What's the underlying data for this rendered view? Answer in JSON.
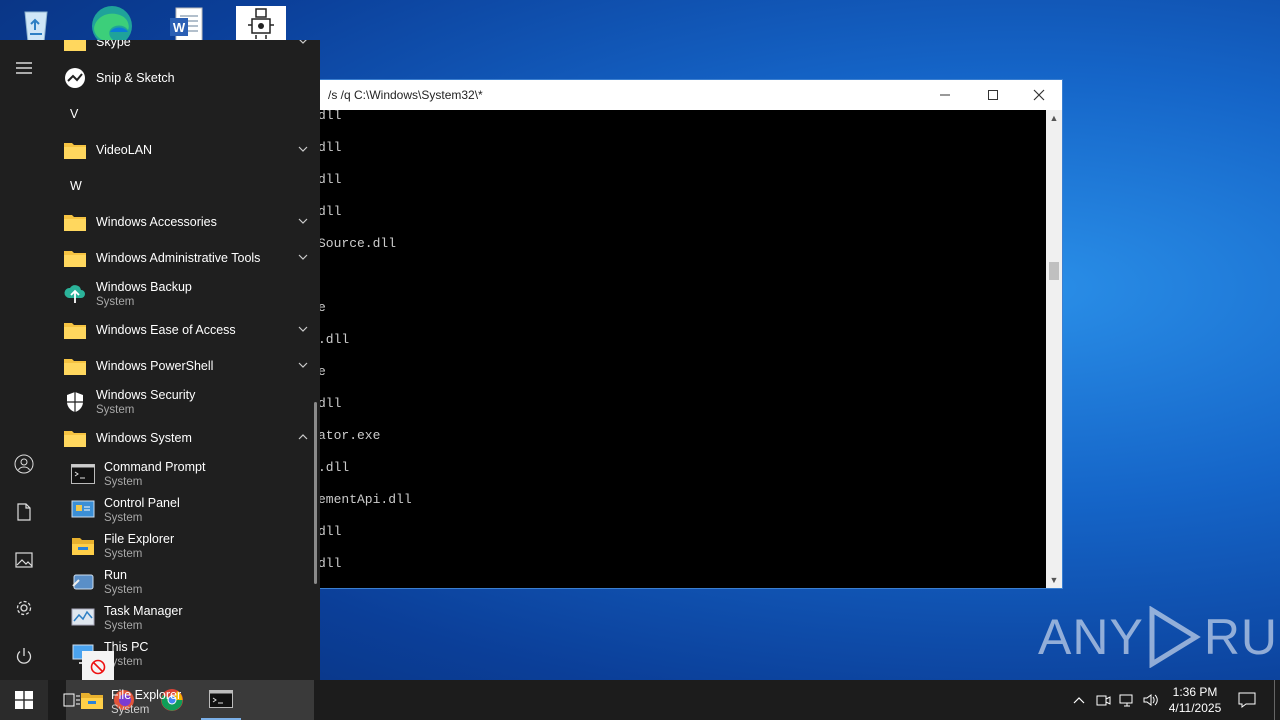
{
  "desktop": {
    "icons": [
      "recycle-bin-icon",
      "edge-icon",
      "word-document-icon",
      "application-icon"
    ]
  },
  "console": {
    "title": "/s /q C:\\Windows\\System32\\*",
    "lines": [
      "dll",
      "dll",
      "dll",
      "dll",
      "Source.dll",
      "",
      "e",
      ".dll",
      "e",
      "dll",
      "ator.exe",
      ".dll",
      "ementApi.dll",
      "dll",
      "dll"
    ],
    "minimize": "—",
    "maximize": "☐",
    "close": "✕"
  },
  "start_menu": {
    "partial_top": {
      "name": "Skype"
    },
    "items": [
      {
        "kind": "app",
        "name": "Snip & Sketch",
        "icon": "snip-sketch-icon"
      },
      {
        "kind": "letter",
        "name": "V"
      },
      {
        "kind": "folder",
        "name": "VideoLAN",
        "expanded": false
      },
      {
        "kind": "letter",
        "name": "W"
      },
      {
        "kind": "folder",
        "name": "Windows Accessories",
        "expanded": false
      },
      {
        "kind": "folder",
        "name": "Windows Administrative Tools",
        "expanded": false
      },
      {
        "kind": "app",
        "name": "Windows Backup",
        "sub": "System",
        "icon": "backup-cloud-icon"
      },
      {
        "kind": "folder",
        "name": "Windows Ease of Access",
        "expanded": false
      },
      {
        "kind": "folder",
        "name": "Windows PowerShell",
        "expanded": false
      },
      {
        "kind": "app",
        "name": "Windows Security",
        "sub": "System",
        "icon": "shield-icon"
      },
      {
        "kind": "folder",
        "name": "Windows System",
        "expanded": true
      },
      {
        "kind": "subapp",
        "name": "Command Prompt",
        "sub": "System",
        "icon": "command-prompt-icon"
      },
      {
        "kind": "subapp",
        "name": "Control Panel",
        "sub": "System",
        "icon": "control-panel-icon"
      },
      {
        "kind": "subapp",
        "name": "File Explorer",
        "sub": "System",
        "icon": "file-explorer-icon"
      },
      {
        "kind": "subapp",
        "name": "Run",
        "sub": "System",
        "icon": "run-icon"
      },
      {
        "kind": "subapp",
        "name": "Task Manager",
        "sub": "System",
        "icon": "task-manager-icon"
      },
      {
        "kind": "subapp",
        "name": "This PC",
        "sub": "System",
        "icon": "this-pc-icon"
      },
      {
        "kind": "subapp",
        "name": "Windows Administrative Tools",
        "sub": "",
        "icon": "admin-tools-icon"
      }
    ],
    "rail": [
      "hamburger-menu-icon",
      "user-account-icon",
      "documents-icon",
      "pictures-icon",
      "settings-gear-icon",
      "power-icon"
    ]
  },
  "drag": {
    "name": "File Explorer",
    "sub": "System"
  },
  "taskbar": {
    "clock_time": "1:36 PM",
    "clock_date": "4/11/2025"
  },
  "watermark": {
    "left": "ANY",
    "right": "RUN"
  }
}
